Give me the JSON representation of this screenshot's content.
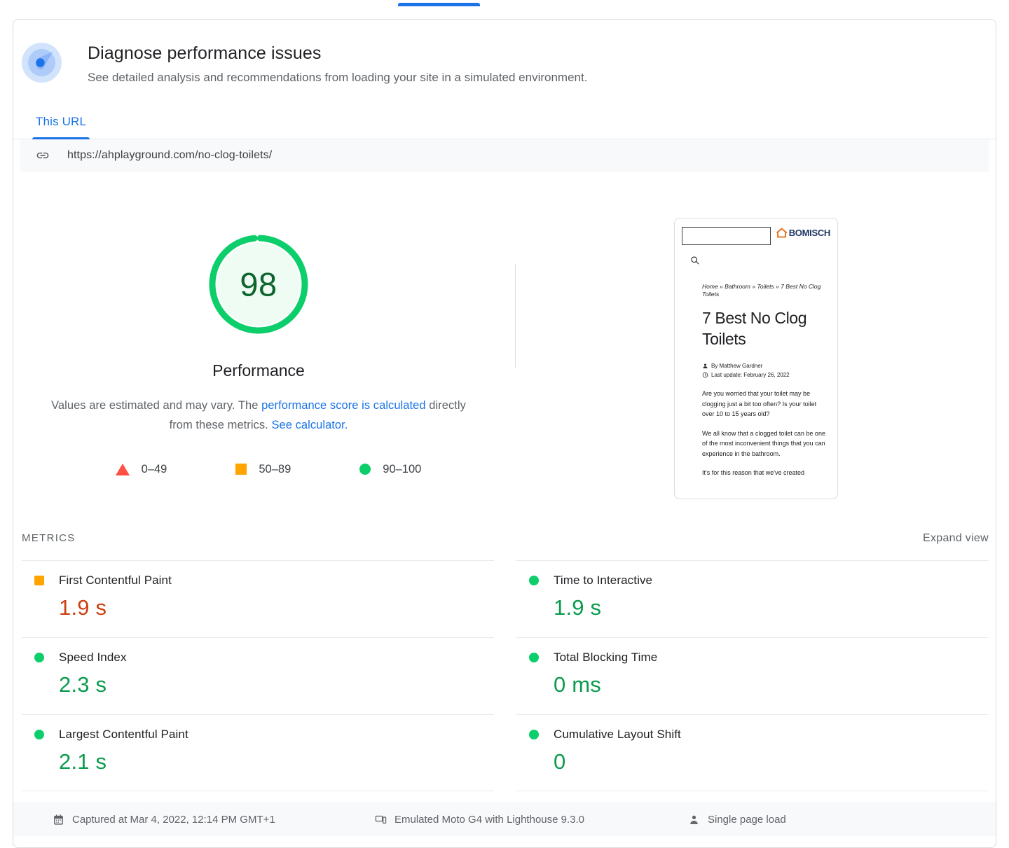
{
  "top_tab": {
    "indicator": "active-tab-indicator"
  },
  "header": {
    "icon": "lighthouse-icon",
    "title": "Diagnose performance issues",
    "subtitle": "See detailed analysis and recommendations from loading your site in a simulated environment."
  },
  "tabs": [
    {
      "label": "This URL",
      "active": true
    }
  ],
  "url_bar": {
    "icon": "link-icon",
    "url": "https://ahplayground.com/no-clog-toilets/"
  },
  "score": {
    "value": "98",
    "value_number": 98,
    "label": "Performance",
    "ring_color": "#0cce6b",
    "number_color": "#0d652d",
    "description_part1": "Values are estimated and may vary. The ",
    "description_link1": "performance score is calculated",
    "description_part2": " directly from these metrics. ",
    "description_link2": "See calculator."
  },
  "legend": [
    {
      "icon": "red-triangle-icon",
      "label": "0–49",
      "color": "#ff4e42",
      "shape": "triangle"
    },
    {
      "icon": "orange-square-icon",
      "label": "50–89",
      "color": "#ffa400",
      "shape": "square"
    },
    {
      "icon": "green-circle-icon",
      "label": "90–100",
      "color": "#0cce6b",
      "shape": "circle"
    }
  ],
  "screenshot": {
    "logo_text": "BOMISCH",
    "logo_icon": "house-logo-icon",
    "search_icon": "search-icon",
    "breadcrumb": "Home » Bathroom » Toilets » 7 Best No Clog Toilets",
    "title": "7 Best No Clog Toilets",
    "author_icon": "person-icon",
    "author": "By Matthew Gardner",
    "date_icon": "clock-icon",
    "date": "Last update: February 26, 2022",
    "paragraph1": "Are you worried that your toilet may be clogging just a bit too often? Is your toilet over 10 to 15 years old?",
    "paragraph2": "We all know that a clogged toilet can be one of the most inconvenient things that you can experience in the bathroom.",
    "paragraph3": "It's for this reason that we've created"
  },
  "metrics_section": {
    "title": "METRICS",
    "expand_label": "Expand view"
  },
  "metrics_left": [
    {
      "name": "First Contentful Paint",
      "value": "1.9 s",
      "shape": "square",
      "dot_color": "#ffa400",
      "value_color": "#cc4112"
    },
    {
      "name": "Speed Index",
      "value": "2.3 s",
      "shape": "circle",
      "dot_color": "#0cce6b",
      "value_color": "#0a9b4d"
    },
    {
      "name": "Largest Contentful Paint",
      "value": "2.1 s",
      "shape": "circle",
      "dot_color": "#0cce6b",
      "value_color": "#0a9b4d"
    }
  ],
  "metrics_right": [
    {
      "name": "Time to Interactive",
      "value": "1.9 s",
      "shape": "circle",
      "dot_color": "#0cce6b",
      "value_color": "#0a9b4d"
    },
    {
      "name": "Total Blocking Time",
      "value": "0 ms",
      "shape": "circle",
      "dot_color": "#0cce6b",
      "value_color": "#0a9b4d"
    },
    {
      "name": "Cumulative Layout Shift",
      "value": "0",
      "shape": "circle",
      "dot_color": "#0cce6b",
      "value_color": "#0a9b4d"
    }
  ],
  "footer": [
    {
      "icon": "calendar-icon",
      "label": "Captured at Mar 4, 2022, 12:14 PM GMT+1"
    },
    {
      "icon": "device-icon",
      "label": "Emulated Moto G4 with Lighthouse 9.3.0"
    },
    {
      "icon": "person-icon",
      "label": "Single page load"
    }
  ]
}
